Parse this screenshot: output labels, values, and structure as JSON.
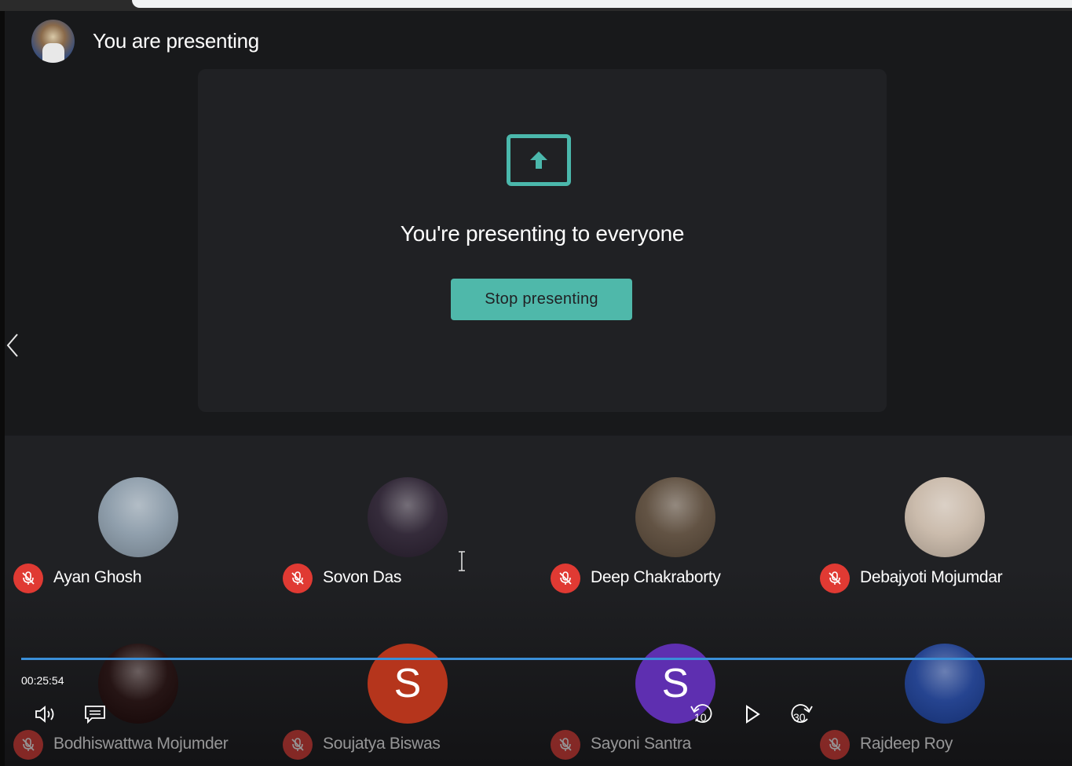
{
  "header": {
    "title": "You are presenting"
  },
  "presentation": {
    "message": "You're presenting to everyone",
    "stop_button": "Stop presenting"
  },
  "participants": [
    {
      "name": "Ayan Ghosh",
      "initial": "",
      "avatar_color": "#8a9aa8",
      "muted": true
    },
    {
      "name": "Sovon Das",
      "initial": "",
      "avatar_color": "#2a2030",
      "muted": true
    },
    {
      "name": "Deep Chakraborty",
      "initial": "",
      "avatar_color": "#5a4a3a",
      "muted": true
    },
    {
      "name": "Debajyoti Mojumdar",
      "initial": "",
      "avatar_color": "#c8b8a8",
      "muted": true
    },
    {
      "name": "Bodhiswattwa Mojumder",
      "initial": "",
      "avatar_color": "#1a0808",
      "muted": true
    },
    {
      "name": "Soujatya Biswas",
      "initial": "S",
      "avatar_color": "#b5351c",
      "muted": true
    },
    {
      "name": "Sayoni Santra",
      "initial": "S",
      "avatar_color": "#5e2fb0",
      "muted": true
    },
    {
      "name": "Rajdeep Roy",
      "initial": "",
      "avatar_color": "#1a3a8a",
      "muted": true
    }
  ],
  "player": {
    "timestamp": "00:25:54",
    "rewind_seconds": "10",
    "forward_seconds": "30"
  },
  "colors": {
    "accent": "#4fb8aa",
    "mic_off": "#e03a33",
    "progress": "#3a8fd8"
  }
}
